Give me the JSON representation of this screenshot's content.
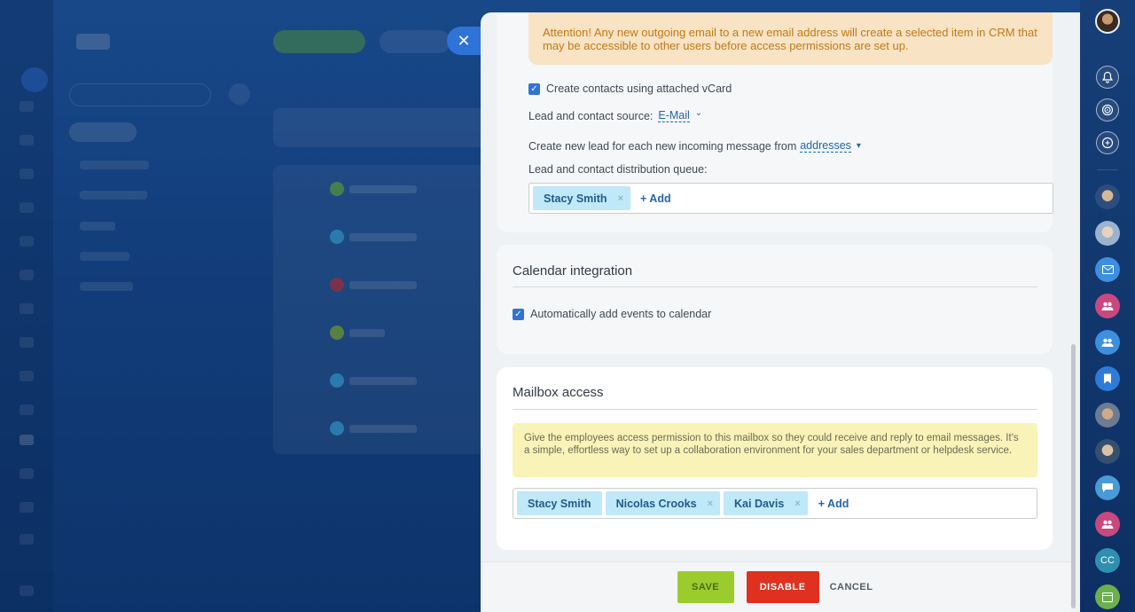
{
  "panel": {
    "attention_text": "Attention! Any new outgoing email to a new email address will create a selected item in CRM that may be accessible to other users before access permissions are set up.",
    "create_contacts_label": "Create contacts using attached vCard",
    "lead_source_label": "Lead and contact source:",
    "lead_source_value": "E-Mail",
    "create_lead_label": "Create new lead for each new incoming message from",
    "create_lead_value": "addresses",
    "distribution_label": "Lead and contact distribution queue:",
    "distribution_tags": [
      "Stacy Smith"
    ],
    "add_label": "+ Add",
    "calendar": {
      "title": "Calendar integration",
      "auto_add_label": "Automatically add events to calendar"
    },
    "mailbox_access": {
      "title": "Mailbox access",
      "info_text": "Give the employees access permission to this mailbox so they could receive and reply to email messages. It's a simple, effortless way to set up a collaboration environment for your sales department or helpdesk service.",
      "tags": [
        "Stacy Smith",
        "Nicolas Crooks",
        "Kai Davis"
      ]
    }
  },
  "footer": {
    "save": "SAVE",
    "disable": "DISABLE",
    "cancel": "CANCEL"
  },
  "right_rail": {
    "initials_avatar": "CC"
  },
  "icons": {
    "close": "✕",
    "check": "✓",
    "remove": "×",
    "chevron_down": "⌄",
    "caret_down": "▾"
  },
  "colors": {
    "accent_blue": "#2f73d9",
    "save_green": "#9bcc2d",
    "disable_red": "#e0301f",
    "tag_bg": "#bfe8f9",
    "attention_bg": "#f8e3c4",
    "info_bg": "#f9f3b7"
  }
}
